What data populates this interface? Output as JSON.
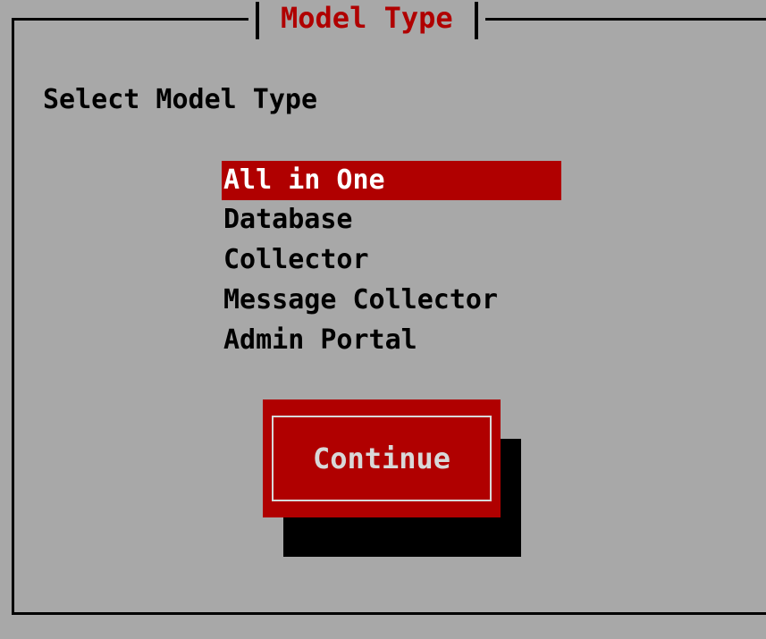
{
  "dialog": {
    "title": "Model Type",
    "prompt": "Select Model Type"
  },
  "menu": {
    "items": [
      {
        "label": "All in One",
        "selected": true
      },
      {
        "label": "Database",
        "selected": false
      },
      {
        "label": "Collector",
        "selected": false
      },
      {
        "label": "Message Collector",
        "selected": false
      },
      {
        "label": "Admin Portal",
        "selected": false
      }
    ]
  },
  "actions": {
    "continue_label": "Continue"
  },
  "colors": {
    "background": "#a8a8a8",
    "accent": "#b00000",
    "selected_text": "#ffffff",
    "button_text": "#d8d8d8",
    "border": "#000000"
  }
}
